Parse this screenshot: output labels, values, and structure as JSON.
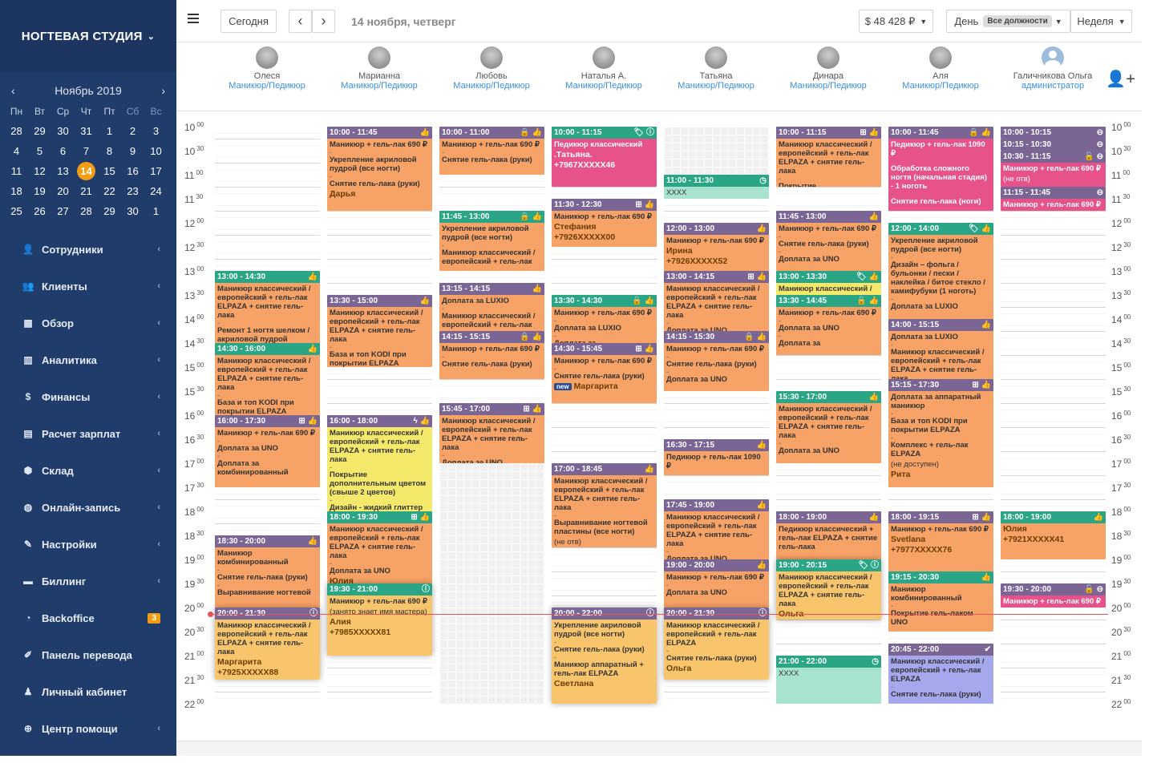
{
  "brand": {
    "name": "НОГТЕВАЯ СТУДИЯ"
  },
  "calendar": {
    "month": "Ноябрь 2019",
    "dow": [
      "Пн",
      "Вт",
      "Ср",
      "Чт",
      "Пт",
      "Сб",
      "Вс"
    ],
    "weeks": [
      [
        "28",
        "29",
        "30",
        "31",
        "1",
        "2",
        "3"
      ],
      [
        "4",
        "5",
        "6",
        "7",
        "8",
        "9",
        "10"
      ],
      [
        "11",
        "12",
        "13",
        "14",
        "15",
        "16",
        "17"
      ],
      [
        "18",
        "19",
        "20",
        "21",
        "22",
        "23",
        "24"
      ],
      [
        "25",
        "26",
        "27",
        "28",
        "29",
        "30",
        "1"
      ]
    ],
    "today": "14"
  },
  "menu": [
    {
      "label": "Сотрудники",
      "icon": "users-icon",
      "glyph": "👤",
      "arrow": true
    },
    {
      "label": "Клиенты",
      "icon": "clients-icon",
      "glyph": "👥",
      "arrow": true
    },
    {
      "label": "Обзор",
      "icon": "dashboard-icon",
      "glyph": "▦",
      "arrow": true
    },
    {
      "label": "Аналитика",
      "icon": "chart-icon",
      "glyph": "▥",
      "arrow": true
    },
    {
      "label": "Финансы",
      "icon": "dollar-icon",
      "glyph": "$",
      "arrow": true
    },
    {
      "label": "Расчет зарплат",
      "icon": "id-card-icon",
      "glyph": "▤",
      "arrow": true
    },
    {
      "label": "Склад",
      "icon": "cubes-icon",
      "glyph": "⬢",
      "arrow": true
    },
    {
      "label": "Онлайн-запись",
      "icon": "globe-icon",
      "glyph": "◍",
      "arrow": true
    },
    {
      "label": "Настройки",
      "icon": "wrench-icon",
      "glyph": "✎",
      "arrow": true
    },
    {
      "label": "Биллинг",
      "icon": "credit-card-icon",
      "glyph": "▬",
      "arrow": true
    },
    {
      "label": "Backoffice",
      "icon": "gauge-icon",
      "glyph": "◔",
      "badge": "3"
    },
    {
      "label": "Панель перевода",
      "icon": "edit-icon",
      "glyph": "✐",
      "arrow": false
    },
    {
      "label": "Личный кабинет",
      "icon": "person-icon",
      "glyph": "♟",
      "arrow": false
    },
    {
      "label": "Центр помощи",
      "icon": "lifebuoy-icon",
      "glyph": "⊕",
      "arrow": true
    }
  ],
  "topbar": {
    "today": "Сегодня",
    "prev": "‹",
    "next": "›",
    "date": "14 ноября, четверг",
    "cash": "$ 48 428 ₽",
    "view": "День",
    "filter": "Все должности",
    "period": "Неделя"
  },
  "staff": [
    {
      "name": "Олеся",
      "pos": "Маникюр/Педикюр"
    },
    {
      "name": "Марианна",
      "pos": "Маникюр/Педикюр"
    },
    {
      "name": "Любовь",
      "pos": "Маникюр/Педикюр"
    },
    {
      "name": "Наталья А.",
      "pos": "Маникюр/Педикюр"
    },
    {
      "name": "Татьяна",
      "pos": "Маникюр/Педикюр"
    },
    {
      "name": "Динара",
      "pos": "Маникюр/Педикюр"
    },
    {
      "name": "Аля",
      "pos": "Маникюр/Педикюр"
    },
    {
      "name": "Галичникова Ольга",
      "pos": "администратор"
    }
  ],
  "times": [
    [
      "10",
      "00"
    ],
    [
      "10",
      "30"
    ],
    [
      "11",
      "00"
    ],
    [
      "11",
      "30"
    ],
    [
      "12",
      "00"
    ],
    [
      "12",
      "30"
    ],
    [
      "13",
      "00"
    ],
    [
      "13",
      "30"
    ],
    [
      "14",
      "00"
    ],
    [
      "14",
      "30"
    ],
    [
      "15",
      "00"
    ],
    [
      "15",
      "30"
    ],
    [
      "16",
      "00"
    ],
    [
      "16",
      "30"
    ],
    [
      "17",
      "00"
    ],
    [
      "17",
      "30"
    ],
    [
      "18",
      "00"
    ],
    [
      "18",
      "30"
    ],
    [
      "19",
      "00"
    ],
    [
      "19",
      "30"
    ],
    [
      "20",
      "00"
    ],
    [
      "20",
      "30"
    ],
    [
      "21",
      "00"
    ],
    [
      "21",
      "30"
    ],
    [
      "22",
      "00"
    ]
  ],
  "events": [
    {
      "col": 0,
      "s": "13:00",
      "e": "14:30",
      "time": "13:00 - 14:30",
      "hc": "gr",
      "bc": "o",
      "icons": "👍",
      "lines": [
        "Маникюр классический / европейский + гель-лак ELPAZA + снятие гель-лака",
        "-",
        "Ремонт 1 ногтя шелком / акриловой пудрой"
      ]
    },
    {
      "col": 0,
      "s": "14:30",
      "e": "16:00",
      "time": "14:30 - 16:00",
      "hc": "gr",
      "bc": "o",
      "icons": "👍",
      "lines": [
        "Маникюр классический / европейский + гель-лак ELPAZA + снятие гель-лака",
        "-",
        "База и топ KODI при покрытии ELPAZA"
      ]
    },
    {
      "col": 0,
      "s": "16:00",
      "e": "17:30",
      "time": "16:00 - 17:30",
      "hc": "pu",
      "bc": "o",
      "icons": "⊞ 👍",
      "lines": [
        "Маникюр + гель-лак 690 ₽",
        "-",
        "Доплата за UNO",
        "-",
        "Доплата за комбинированный"
      ]
    },
    {
      "col": 0,
      "s": "18:30",
      "e": "20:00",
      "time": "18:30 - 20:00",
      "hc": "pu",
      "bc": "o",
      "icons": "👍",
      "lines": [
        "Маникюр комбинированный",
        "-",
        "Снятие гель-лака (руки)",
        "-",
        "Выравнивание ногтевой"
      ]
    },
    {
      "col": 0,
      "s": "20:00",
      "e": "21:30",
      "time": "20:00 - 21:30",
      "hc": "pu",
      "bc": "g",
      "icons": "ⓘ",
      "shadow": true,
      "lines": [
        "Маникюр классический / европейский + гель-лак ELPAZA + снятие гель-лака"
      ],
      "name": "Маргарита",
      "phone": "+7925XXXXX88"
    },
    {
      "col": 1,
      "s": "10:00",
      "e": "11:45",
      "time": "10:00 - 11:45",
      "hc": "pu",
      "bc": "o",
      "icons": "👍",
      "lines": [
        "Маникюр + гель-лак 690 ₽",
        "-",
        "Укрепление акриловой пудрой (все ногти)",
        "-",
        "Снятие гель-лака (руки)"
      ],
      "name": "Дарья"
    },
    {
      "col": 1,
      "s": "13:30",
      "e": "15:00",
      "time": "13:30 - 15:00",
      "hc": "pu",
      "bc": "o",
      "icons": "👍",
      "lines": [
        "Маникюр классический / европейский + гель-лак ELPAZA + снятие гель-лака",
        "-",
        "База и топ KODI при покрытии ELPAZA"
      ]
    },
    {
      "col": 1,
      "s": "16:00",
      "e": "18:00",
      "time": "16:00 - 18:00",
      "hc": "pu",
      "bc": "y",
      "icons": "ϟ 👍",
      "lines": [
        "Маникюр классический / европейский + гель-лак ELPAZA + снятие гель-лака",
        "-",
        "Покрытие дополнительным цветом (свыше 2 цветов)",
        "-",
        "Дизайн - жидкий глиттер"
      ]
    },
    {
      "col": 1,
      "s": "18:00",
      "e": "19:30",
      "time": "18:00 - 19:30",
      "hc": "gr",
      "bc": "o",
      "icons": "⊞ 👍",
      "lines": [
        "Маникюр классический / европейский + гель-лак ELPAZA + снятие гель-лака",
        "-",
        "Доплата за UNO"
      ],
      "name": "Юлия"
    },
    {
      "col": 1,
      "s": "19:30",
      "e": "21:00",
      "time": "19:30 - 21:00",
      "hc": "gr",
      "bc": "g",
      "icons": "ⓘ",
      "shadow": true,
      "lines": [
        "Маникюр + гель-лак 690 ₽"
      ],
      "note": "(занято знает имя мастера)",
      "name": "Алия",
      "phone": "+7985XXXXX81"
    },
    {
      "col": 2,
      "s": "10:00",
      "e": "11:00",
      "time": "10:00 - 11:00",
      "hc": "pu",
      "bc": "o",
      "icons": "🔒 👍",
      "lines": [
        "Маникюр + гель-лак 690 ₽",
        "-",
        "Снятие гель-лака (руки)"
      ]
    },
    {
      "col": 2,
      "s": "11:45",
      "e": "13:00",
      "time": "11:45 - 13:00",
      "hc": "gr",
      "bc": "o",
      "icons": "🔒 👍",
      "lines": [
        "Укрепление акриловой пудрой (все ногти)",
        "-",
        "Маникюр классический / европейский + гель-лак"
      ]
    },
    {
      "col": 2,
      "s": "13:15",
      "e": "14:15",
      "time": "13:15 - 14:15",
      "hc": "pu",
      "bc": "o",
      "icons": "👍",
      "lines": [
        "Доплата за LUXIO",
        "-",
        "Маникюр классический / европейский + гель-лак"
      ]
    },
    {
      "col": 2,
      "s": "14:15",
      "e": "15:15",
      "time": "14:15 - 15:15",
      "hc": "pu",
      "bc": "o",
      "icons": "🔒 👍",
      "lines": [
        "Маникюр + гель-лак 690 ₽",
        "-",
        "Снятие гель-лака (руки)"
      ]
    },
    {
      "col": 2,
      "s": "15:45",
      "e": "17:00",
      "time": "15:45 - 17:00",
      "hc": "pu",
      "bc": "o",
      "icons": "⊞ 👍",
      "lines": [
        "Маникюр классический / европейский + гель-лак ELPAZA + снятие гель-лака",
        "-",
        "Доплата за UNO"
      ]
    },
    {
      "col": 3,
      "s": "10:00",
      "e": "11:15",
      "time": "10:00 - 11:15",
      "hc": "gr",
      "bc": "p",
      "icons": "🏷 ⓘ",
      "lines": [
        "Педикюр классический"
      ],
      "name": ".Татьяна.",
      "phone": "+7967XXXXX46"
    },
    {
      "col": 3,
      "s": "11:30",
      "e": "12:30",
      "time": "11:30 - 12:30",
      "hc": "pu",
      "bc": "o",
      "icons": "⊞ 👍",
      "lines": [
        "Маникюр + гель-лак 690 ₽"
      ],
      "name": "Стефания",
      "phone": "+7926XXXXX00"
    },
    {
      "col": 3,
      "s": "13:30",
      "e": "14:30",
      "time": "13:30 - 14:30",
      "hc": "gr",
      "bc": "o",
      "icons": "🔒 👍",
      "lines": [
        "Маникюр + гель-лак 690 ₽",
        "-",
        "Доплата за LUXIO",
        "-",
        "Доплата за"
      ]
    },
    {
      "col": 3,
      "s": "14:30",
      "e": "15:45",
      "time": "14:30 - 15:45",
      "hc": "pu",
      "bc": "o",
      "icons": "⊞ 👍",
      "lines": [
        "Маникюр + гель-лак 690 ₽",
        "-",
        "Снятие гель-лака (руки)"
      ],
      "newname": "Маргарита",
      "newtag": "new"
    },
    {
      "col": 3,
      "s": "17:00",
      "e": "18:45",
      "time": "17:00 - 18:45",
      "hc": "pu",
      "bc": "o",
      "icons": "👍",
      "lines": [
        "Маникюр классический / европейский + гель-лак ELPAZA + снятие гель-лака",
        "-",
        "Выравнивание ногтевой пластины (все ногти)"
      ],
      "note": "(не отв)"
    },
    {
      "col": 3,
      "s": "20:00",
      "e": "22:00",
      "time": "20:00 - 22:00",
      "hc": "pu",
      "bc": "g",
      "icons": "ⓘ",
      "shadow": true,
      "lines": [
        "Укрепление акриловой пудрой (все ногти)",
        "-",
        "Снятие гель-лака (руки)",
        "-",
        "Маникюр аппаратный + гель-лак ELPAZA"
      ],
      "name": "Светлана"
    },
    {
      "col": 4,
      "s": "11:00",
      "e": "11:30",
      "time": "11:00 - 11:30",
      "hc": "gr",
      "bc": "t",
      "icons": "◷",
      "plain": "XXXX"
    },
    {
      "col": 4,
      "s": "12:00",
      "e": "13:00",
      "time": "12:00 - 13:00",
      "hc": "pu",
      "bc": "o",
      "icons": "👍",
      "lines": [
        "Маникюр + гель-лак 690 ₽"
      ],
      "name": "Ирина",
      "phone": "+7926XXXXX52"
    },
    {
      "col": 4,
      "s": "13:00",
      "e": "14:15",
      "time": "13:00 - 14:15",
      "hc": "pu",
      "bc": "o",
      "icons": "⊞ 👍",
      "lines": [
        "Маникюр классический / европейский + гель-лак ELPAZA + снятие гель-лака",
        "-",
        "Доплата за UNO"
      ]
    },
    {
      "col": 4,
      "s": "14:15",
      "e": "15:30",
      "time": "14:15 - 15:30",
      "hc": "pu",
      "bc": "o",
      "icons": "🔒 👍",
      "lines": [
        "Маникюр + гель-лак 690 ₽",
        "-",
        "Снятие гель-лака (руки)",
        "-",
        "Доплата за UNO"
      ]
    },
    {
      "col": 4,
      "s": "16:30",
      "e": "17:15",
      "time": "16:30 - 17:15",
      "hc": "pu",
      "bc": "o",
      "icons": "👍",
      "lines": [
        "Педикюр + гель-лак 1090 ₽"
      ]
    },
    {
      "col": 4,
      "s": "17:45",
      "e": "19:00",
      "time": "17:45 - 19:00",
      "hc": "pu",
      "bc": "o",
      "icons": "👍",
      "lines": [
        "Маникюр классический / европейский + гель-лак ELPAZA + снятие гель-лака",
        "-",
        "Доплата за UNO"
      ]
    },
    {
      "col": 4,
      "s": "19:00",
      "e": "20:00",
      "time": "19:00 - 20:00",
      "hc": "pu",
      "bc": "o",
      "icons": "👍",
      "lines": [
        "Маникюр + гель-лак 690 ₽",
        "-",
        "Доплата за UNO"
      ]
    },
    {
      "col": 4,
      "s": "20:00",
      "e": "21:30",
      "time": "20:00 - 21:30",
      "hc": "pu",
      "bc": "g",
      "icons": "ⓘ",
      "shadow": true,
      "lines": [
        "Маникюр классический / европейский + гель-лак ELPAZA",
        "-",
        "Снятие гель-лака (руки)"
      ],
      "name": "Ольга"
    },
    {
      "col": 5,
      "s": "10:00",
      "e": "11:15",
      "time": "10:00 - 11:15",
      "hc": "pu",
      "bc": "o",
      "icons": "⊞ 👍",
      "lines": [
        "Маникюр классический / европейский + гель-лак ELPAZA + снятие гель-лака",
        "-",
        "Покрытие"
      ]
    },
    {
      "col": 5,
      "s": "11:45",
      "e": "13:00",
      "time": "11:45 - 13:00",
      "hc": "pu",
      "bc": "o",
      "icons": "👍",
      "lines": [
        "Маникюр + гель-лак 690 ₽",
        "-",
        "Снятие гель-лака (руки)",
        "-",
        "Доплата за UNO"
      ]
    },
    {
      "col": 5,
      "s": "13:00",
      "e": "13:30",
      "time": "13:00 - 13:30",
      "hc": "gr",
      "bc": "y",
      "icons": "🏷 👍",
      "lines": [
        "Маникюр классический /"
      ]
    },
    {
      "col": 5,
      "s": "13:30",
      "e": "14:45",
      "time": "13:30 - 14:45",
      "hc": "gr",
      "bc": "o",
      "icons": "🔒 👍",
      "lines": [
        "Маникюр + гель-лак 690 ₽",
        "-",
        "Доплата за UNO",
        "-",
        "Доплата за"
      ]
    },
    {
      "col": 5,
      "s": "15:30",
      "e": "17:00",
      "time": "15:30 - 17:00",
      "hc": "gr",
      "bc": "o",
      "icons": "👍",
      "lines": [
        "Маникюр классический / европейский + гель-лак ELPAZA + снятие гель-лака",
        "-",
        "Доплата за UNO"
      ]
    },
    {
      "col": 5,
      "s": "18:00",
      "e": "19:00",
      "time": "18:00 - 19:00",
      "hc": "pu",
      "bc": "o",
      "icons": "👍",
      "lines": [
        "Педикюр классический + гель-лак ELPAZA + снятие гель-лака"
      ]
    },
    {
      "col": 5,
      "s": "19:00",
      "e": "20:15",
      "time": "19:00 - 20:15",
      "hc": "gr",
      "bc": "g",
      "icons": "🏷 ⓘ",
      "shadow": true,
      "lines": [
        "Маникюр классический / европейский + гель-лак ELPAZA + снятие гель-лака"
      ],
      "name": "Ольга"
    },
    {
      "col": 5,
      "s": "21:00",
      "e": "22:00",
      "time": "21:00 - 22:00",
      "hc": "gr",
      "bc": "t",
      "icons": "◷",
      "plain": "XXXX"
    },
    {
      "col": 6,
      "s": "10:00",
      "e": "11:45",
      "time": "10:00 - 11:45",
      "hc": "pu",
      "bc": "p",
      "icons": "🔒 👍",
      "lines": [
        "Педикюр + гель-лак 1090 ₽",
        "-",
        "Обработка сложного ногтя (начальная стадия) - 1 ноготь",
        "-",
        "Снятие гель-лака (ноги)"
      ]
    },
    {
      "col": 6,
      "s": "12:00",
      "e": "14:00",
      "time": "12:00 - 14:00",
      "hc": "gr",
      "bc": "o",
      "icons": "🏷 👍",
      "lines": [
        "Укрепление акриловой пудрой (все ногти)",
        "-",
        "Дизайн – фольга / бульонки / пески / наклейка / битое стекло / камифубуки (1 ноготь)",
        "-",
        "Доплата за LUXIO"
      ]
    },
    {
      "col": 6,
      "s": "14:00",
      "e": "15:15",
      "time": "14:00 - 15:15",
      "hc": "pu",
      "bc": "o",
      "icons": "👍",
      "lines": [
        "Доплата за LUXIO",
        "-",
        "Маникюр классический / европейский + гель-лак ELPAZA + снятие гель-лака"
      ]
    },
    {
      "col": 6,
      "s": "15:15",
      "e": "17:30",
      "time": "15:15 - 17:30",
      "hc": "pu",
      "bc": "o",
      "icons": "⊞ 👍",
      "lines": [
        "Доплата за аппаратный маникюр",
        "-",
        "База и топ KODI при покрытии ELPAZA",
        "-",
        "Комплекс + гель-лак ELPAZA"
      ],
      "note": "(не доступен)",
      "name": "Рита"
    },
    {
      "col": 6,
      "s": "18:00",
      "e": "19:15",
      "time": "18:00 - 19:15",
      "hc": "pu",
      "bc": "o",
      "icons": "⊞ 👍",
      "lines": [
        "Маникюр + гель-лак 690 ₽"
      ],
      "name": "Svetlana",
      "phone": "+7977XXXXX76"
    },
    {
      "col": 6,
      "s": "19:15",
      "e": "20:30",
      "time": "19:15 - 20:30",
      "hc": "gr",
      "bc": "o",
      "icons": "👍",
      "lines": [
        "Маникюр комбинированный",
        "-",
        "Покрытие гель-лаком UNO"
      ]
    },
    {
      "col": 6,
      "s": "20:45",
      "e": "22:00",
      "time": "20:45 - 22:00",
      "hc": "pu",
      "bc": "b",
      "icons": "✔",
      "lines": [
        "Маникюр классический / европейский + гель-лак ELPAZA",
        "-",
        "Снятие гель-лака (руки)"
      ]
    },
    {
      "col": 7,
      "s": "10:00",
      "e": "10:15",
      "time": "10:00 - 10:15",
      "hc": "pu",
      "bc": "none",
      "icons": "⊖"
    },
    {
      "col": 7,
      "s": "10:15",
      "e": "10:30",
      "time": "10:15 - 10:30",
      "hc": "pu",
      "bc": "none",
      "icons": "⊖"
    },
    {
      "col": 7,
      "s": "10:30",
      "e": "11:15",
      "time": "10:30 - 11:15",
      "hc": "pu",
      "bc": "p",
      "icons": "🔓 ⊖",
      "lines": [
        "Маникюр + гель-лак 690 ₽"
      ],
      "note": "(не отв)"
    },
    {
      "col": 7,
      "s": "11:15",
      "e": "11:45",
      "time": "11:15 - 11:45",
      "hc": "pu",
      "bc": "p",
      "icons": "⊖",
      "lines": [
        "Маникюр + гель-лак 690 ₽"
      ]
    },
    {
      "col": 7,
      "s": "18:00",
      "e": "19:00",
      "time": "18:00 - 19:00",
      "hc": "gr",
      "bc": "o",
      "icons": "👍",
      "lines": [],
      "name": "Юлия",
      "phone": "+7921XXXXX41"
    },
    {
      "col": 7,
      "s": "19:30",
      "e": "20:00",
      "time": "19:30 - 20:00",
      "hc": "pu",
      "bc": "p",
      "icons": "🔓 ⊖",
      "lines": [
        "Маникюр + гель-лак 690 ₽"
      ]
    }
  ],
  "blocked": [
    {
      "col": 2,
      "s": "17:00",
      "e": "22:00"
    },
    {
      "col": 4,
      "s": "10:00",
      "e": "11:00"
    }
  ]
}
